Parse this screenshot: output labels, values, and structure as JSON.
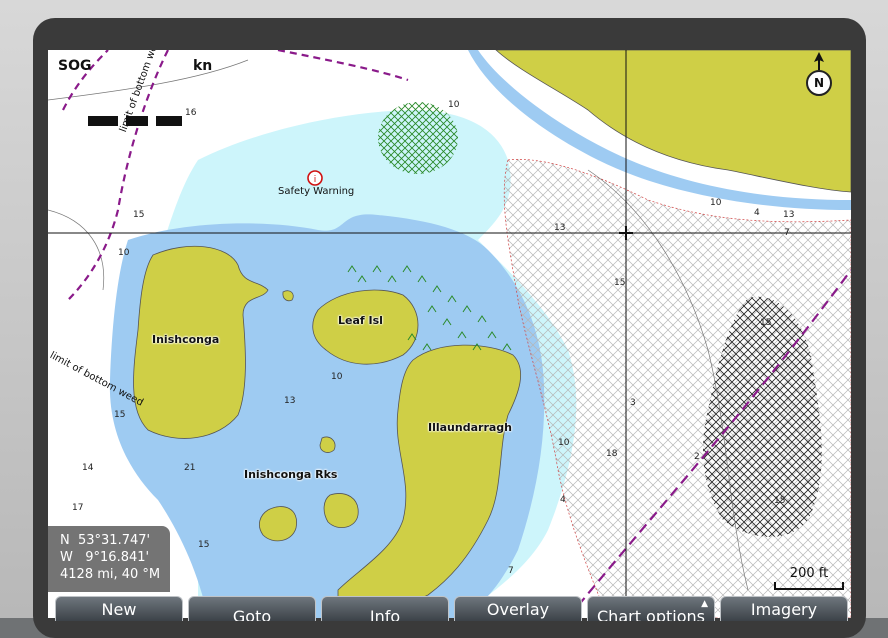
{
  "hud": {
    "sog_label": "SOG",
    "speed_unit": "kn",
    "north_label": "N"
  },
  "coordinates": {
    "lat": "N  53°31.747'",
    "lon": "W   9°16.841'",
    "range": "4128 mi, 40 °M"
  },
  "scale": {
    "label": "200 ft"
  },
  "labels": {
    "safety_warning": "Safety Warning",
    "limit_top": "limit of bottom wee",
    "limit_left": "limit of bottom weed"
  },
  "islands": [
    "Inishconga",
    "Leaf Isl",
    "Illaundarragh",
    "Inishconga Rks"
  ],
  "soundings": [
    "16",
    "10",
    "15",
    "10",
    "13",
    "15",
    "13",
    "14",
    "21",
    "17",
    "10",
    "10",
    "18",
    "4",
    "3",
    "2",
    "15",
    "13",
    "10",
    "4",
    "15",
    "7",
    "15",
    "7",
    "15"
  ],
  "menu": {
    "new": "New",
    "goto": "Goto",
    "info": "Info",
    "overlay": "Overlay",
    "chart_options": "Chart options",
    "imagery": "Imagery"
  },
  "colors": {
    "land": "#cfcf46",
    "shallow": "#9ecbf2",
    "mid": "#cdf5fb",
    "deep": "#ffffff",
    "magenta": "#8a1a8a"
  }
}
